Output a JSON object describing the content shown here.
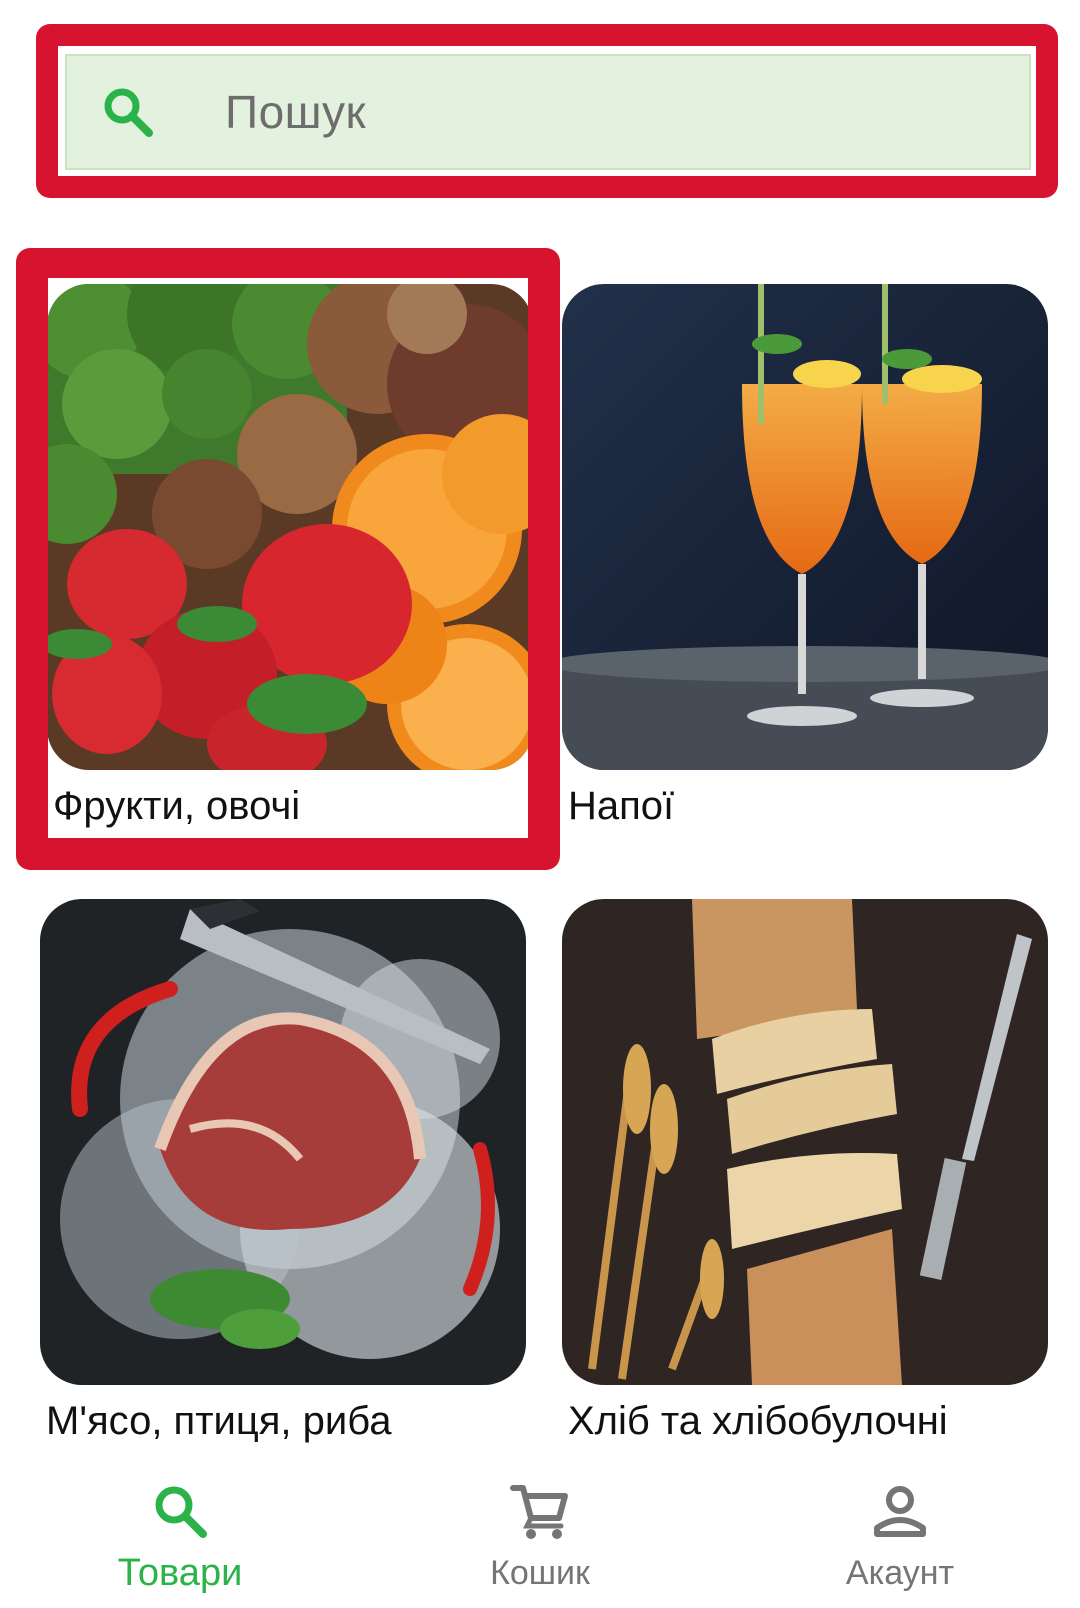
{
  "search": {
    "placeholder": "Пошук",
    "icon": "search-icon"
  },
  "categories": [
    {
      "label": "Фрукти, овочі",
      "image": "fruits-vegetables-photo"
    },
    {
      "label": "Напої",
      "image": "drinks-photo"
    },
    {
      "label": "М'ясо, птиця, риба",
      "image": "meat-photo"
    },
    {
      "label": "Хліб та хлібобулочні",
      "image": "bread-photo"
    }
  ],
  "bottom_nav": {
    "items": [
      {
        "label": "Товари",
        "icon": "search-icon",
        "active": true
      },
      {
        "label": "Кошик",
        "icon": "cart-icon",
        "active": false
      },
      {
        "label": "Акаунт",
        "icon": "account-icon",
        "active": false
      }
    ]
  },
  "colors": {
    "accent": "#2bb34a",
    "highlight": "#d7132f",
    "search_bg": "#e3f2de",
    "inactive": "#757575"
  }
}
